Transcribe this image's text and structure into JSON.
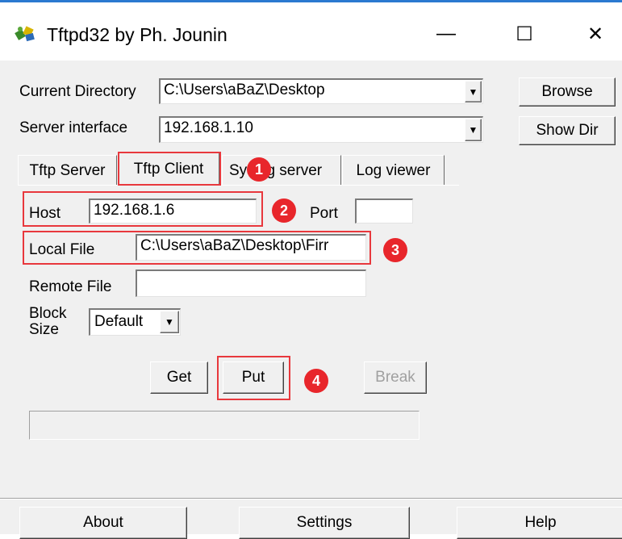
{
  "window": {
    "title": "Tftpd32 by Ph. Jounin",
    "minimize_glyph": "—",
    "maximize_glyph": "☐",
    "close_glyph": "✕"
  },
  "settings": {
    "current_directory_label": "Current Directory",
    "current_directory_value": "C:\\Users\\aBaZ\\Desktop",
    "server_interface_label": "Server interface",
    "server_interface_value": "192.168.1.10",
    "browse_label": "Browse",
    "show_dir_label": "Show Dir"
  },
  "tabs": [
    {
      "label": "Tftp Server",
      "active": false
    },
    {
      "label": "Tftp Client",
      "active": true
    },
    {
      "label": "Syslog server",
      "active": false
    },
    {
      "label": "Log viewer",
      "active": false
    }
  ],
  "client": {
    "host_label": "Host",
    "host_value": "192.168.1.6",
    "port_label": "Port",
    "port_value": "",
    "local_file_label": "Local File",
    "local_file_value": "C:\\Users\\aBaZ\\Desktop\\Firr",
    "remote_file_label": "Remote File",
    "remote_file_value": "",
    "block_size_label_1": "Block",
    "block_size_label_2": "Size",
    "block_size_value": "Default",
    "get_label": "Get",
    "put_label": "Put",
    "break_label": "Break"
  },
  "badges": [
    "1",
    "2",
    "3",
    "4"
  ],
  "bottom_buttons": {
    "about": "About",
    "settings": "Settings",
    "help": "Help"
  },
  "colors": {
    "annotation_red": "#e8262b",
    "window_bg": "#f0f0f0",
    "title_accent": "#2b79d0"
  }
}
